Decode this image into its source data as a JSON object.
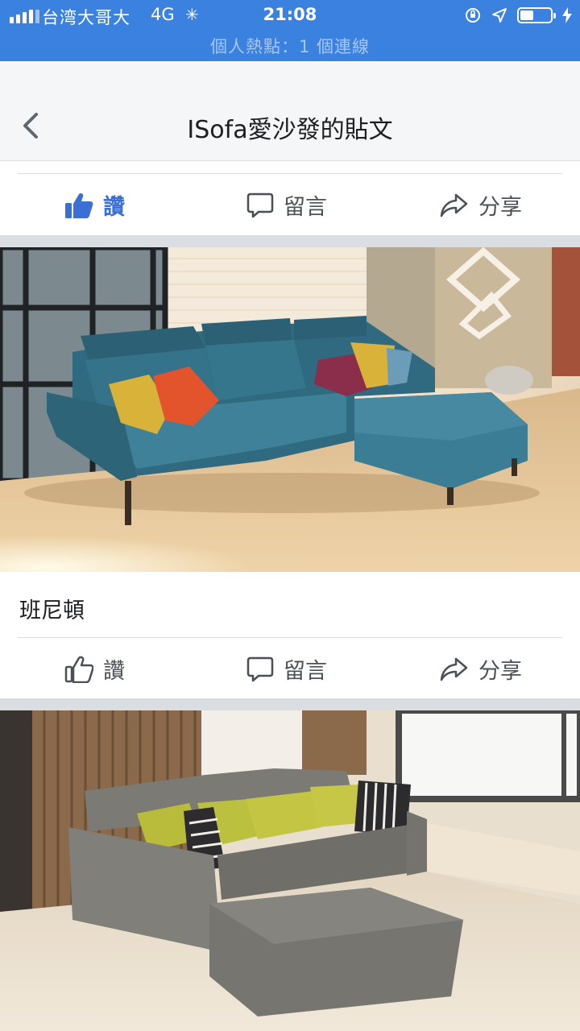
{
  "status_bar": {
    "carrier": "台湾大哥大",
    "network": "4G",
    "time": "21:08",
    "hotspot": "個人熱點：1 個連線"
  },
  "nav": {
    "title": "ISofa愛沙發的貼文"
  },
  "post1": {
    "actions": {
      "like": "讚",
      "comment": "留言",
      "share": "分享"
    },
    "liked": true
  },
  "post2": {
    "caption": "班尼頓",
    "actions": {
      "like": "讚",
      "comment": "留言",
      "share": "分享"
    },
    "liked": false
  },
  "colors": {
    "status_blue": "#3b82e0",
    "liked_blue": "#3b6fd4",
    "action_gray": "#4b4f56",
    "divider": "#dadde1"
  },
  "icons": [
    "chevron-left-icon",
    "thumbs-up-icon",
    "comment-icon",
    "share-icon",
    "location-icon",
    "battery-icon"
  ]
}
